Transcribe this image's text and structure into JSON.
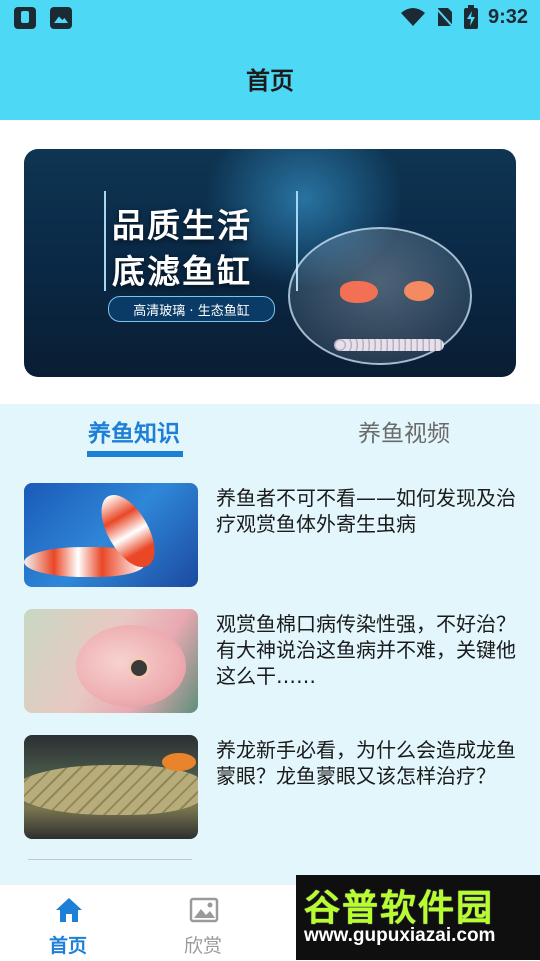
{
  "status_bar": {
    "time": "9:32"
  },
  "header": {
    "title": "首页"
  },
  "banner": {
    "line1": "品质生活",
    "line2": "底滤鱼缸",
    "tagline": "高清玻璃 · 生态鱼缸"
  },
  "tabs": [
    {
      "label": "养鱼知识",
      "active": true
    },
    {
      "label": "养鱼视频",
      "active": false
    }
  ],
  "articles": [
    {
      "title": "养鱼者不可不看——如何发现及治疗观赏鱼体外寄生虫病"
    },
    {
      "title": "观赏鱼棉口病传染性强，不好治？有大神说治这鱼病并不难，关键他这么干……"
    },
    {
      "title": "养龙新手必看，为什么会造成龙鱼蒙眼？龙鱼蒙眼又该怎样治疗？"
    }
  ],
  "bottom_nav": [
    {
      "label": "首页",
      "icon": "home-icon",
      "active": true
    },
    {
      "label": "欣赏",
      "icon": "image-icon",
      "active": false
    }
  ],
  "watermark": {
    "title": "谷普软件园",
    "url": "www.gupuxiazai.com"
  },
  "colors": {
    "header_bg": "#4dd9f5",
    "accent": "#1e7fd6",
    "section_bg": "#e2f6fc"
  }
}
